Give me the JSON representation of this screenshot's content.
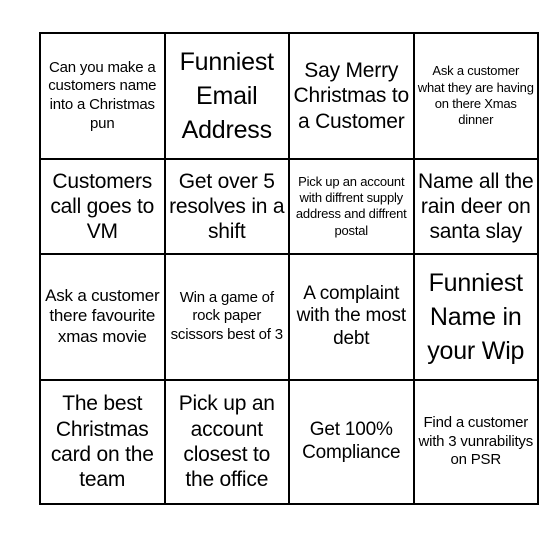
{
  "card": {
    "type": "bingo-card",
    "columns": 4,
    "rows": 4,
    "border_color": "#000000",
    "background_color": "#ffffff",
    "text_color": "#000000",
    "cells": [
      [
        {
          "text": "Can you make a customers name into a Christmas pun",
          "size": "fs-sm"
        },
        {
          "text": "Funniest Email Address",
          "size": "fs-xxl"
        },
        {
          "text": "Say Merry Christmas to a Customer",
          "size": "fs-xl"
        },
        {
          "text": "Ask a customer what they are having on there Xmas dinner",
          "size": "fs-xs"
        }
      ],
      [
        {
          "text": "Customers call goes to VM",
          "size": "fs-xl"
        },
        {
          "text": "Get over 5 resolves in a shift",
          "size": "fs-xl"
        },
        {
          "text": "Pick up an account with diffrent supply address and diffrent postal",
          "size": "fs-xs"
        },
        {
          "text": "Name all the rain deer on santa slay",
          "size": "fs-xl"
        }
      ],
      [
        {
          "text": "Ask a customer there favourite xmas movie",
          "size": "fs-md"
        },
        {
          "text": "Win a game of rock paper scissors best of 3",
          "size": "fs-sm"
        },
        {
          "text": "A complaint with the most debt",
          "size": "fs-lg"
        },
        {
          "text": "Funniest Name in your Wip",
          "size": "fs-xxl"
        }
      ],
      [
        {
          "text": "The best Christmas card on the team",
          "size": "fs-xl"
        },
        {
          "text": "Pick up an account closest to the office",
          "size": "fs-xl"
        },
        {
          "text": "Get 100% Compliance",
          "size": "fs-lg"
        },
        {
          "text": "Find a customer with 3 vunrabilitys on PSR",
          "size": "fs-sm"
        }
      ]
    ]
  }
}
